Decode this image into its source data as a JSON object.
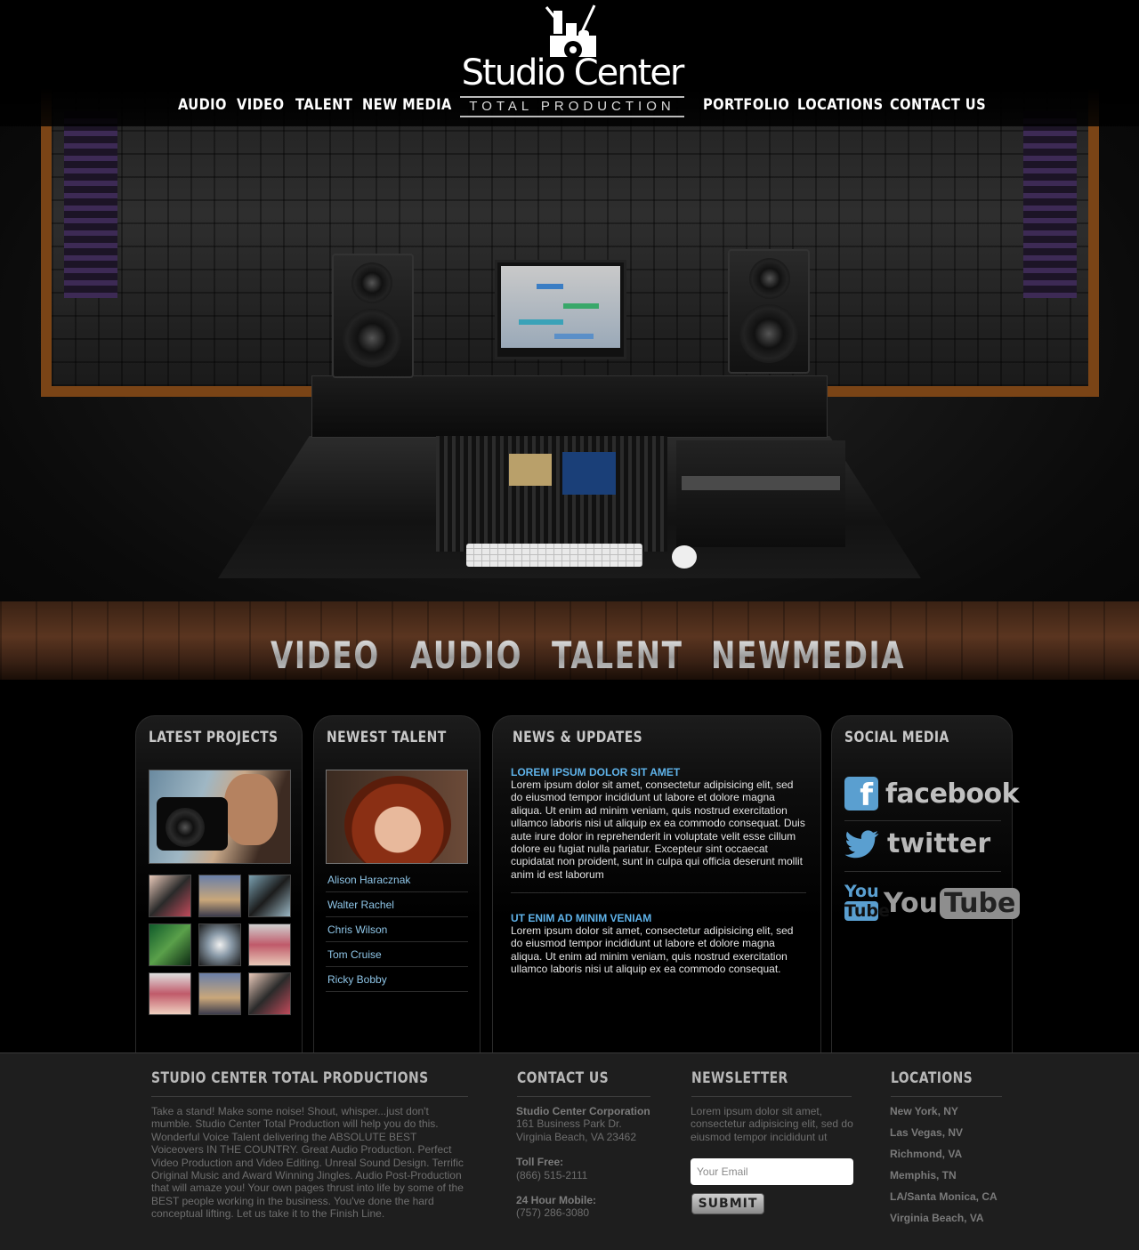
{
  "header": {
    "logo": {
      "word": "Studio Center",
      "sub": "TOTAL PRODUCTION",
      "mark": "®"
    },
    "nav_left": [
      "AUDIO",
      "VIDEO",
      "TALENT",
      "NEW MEDIA"
    ],
    "nav_right": [
      "PORTFOLIO",
      "LOCATIONS",
      "CONTACT US"
    ]
  },
  "categories": [
    "VIDEO",
    "AUDIO",
    "TALENT",
    "NEWMEDIA"
  ],
  "panels": {
    "projects": {
      "title": "LATEST PROJECTS"
    },
    "talent": {
      "title": "NEWEST TALENT",
      "names": [
        "Alison Haracznak",
        "Walter Rachel",
        "Chris Wilson",
        "Tom Cruise",
        "Ricky Bobby"
      ]
    },
    "news": {
      "title": "NEWS & UPDATES",
      "items": [
        {
          "headline": "LOREM IPSUM DOLOR SIT AMET",
          "body": "Lorem ipsum dolor sit amet, consectetur adipisicing elit, sed do eiusmod tempor incididunt ut labore et dolore magna aliqua. Ut enim ad minim veniam, quis nostrud exercitation ullamco laboris nisi ut aliquip ex ea commodo consequat. Duis aute irure dolor in reprehenderit in voluptate velit esse cillum dolore eu fugiat nulla pariatur. Excepteur sint occaecat cupidatat non proident, sunt in culpa qui officia deserunt mollit anim id est laborum"
        },
        {
          "headline": "UT ENIM AD MINIM VENIAM",
          "body": "Lorem ipsum dolor sit amet, consectetur adipisicing elit, sed do eiusmod tempor incididunt ut labore et dolore magna aliqua. Ut enim ad minim veniam, quis nostrud exercitation ullamco laboris nisi ut aliquip ex ea commodo consequat."
        }
      ]
    },
    "social": {
      "title": "SOCIAL MEDIA",
      "facebook": {
        "glyph": "f",
        "word": "facebook"
      },
      "twitter": {
        "word": "twitter"
      },
      "youtube": {
        "you": "You",
        "tube": "Tube"
      }
    }
  },
  "footer": {
    "about": {
      "title": "STUDIO CENTER TOTAL PRODUCTIONS",
      "text": "Take a stand! Make some noise! Shout, whisper...just don't mumble. Studio Center Total Production will help you do this. Wonderful Voice Talent delivering the ABSOLUTE BEST Voiceovers IN THE COUNTRY. Great Audio Production. Perfect Video Production and Video Editing. Unreal Sound Design. Terrific Original Music and Award Winning Jingles. Audio Post-Production that will amaze you! Your own pages thrust into life by some of the BEST people working in the business. You've done the hard conceptual lifting. Let us take it to the Finish Line."
    },
    "contact": {
      "title": "CONTACT US",
      "company": "Studio Center Corporation",
      "address1": "161 Business Park Dr.",
      "address2": "Virginia Beach, VA 23462",
      "tollfree_label": "Toll Free:",
      "tollfree": "(866) 515-2111",
      "mobile_label": "24 Hour Mobile:",
      "mobile": "(757) 286-3080"
    },
    "newsletter": {
      "title": "NEWSLETTER",
      "text": "Lorem ipsum dolor sit amet, consectetur adipisicing elit, sed do eiusmod tempor incididunt ut",
      "placeholder": "Your Email",
      "submit": "SUBMIT"
    },
    "locations": {
      "title": "LOCATIONS",
      "items": [
        "New York, NY",
        "Las Vegas, NV",
        "Richmond, VA",
        "Memphis, TN",
        "LA/Santa Monica, CA",
        "Virginia Beach, VA"
      ]
    }
  },
  "colors": {
    "link_blue": "#8fc6e8",
    "headline_blue": "#5fb3ea",
    "social_blue": "#5a9fd0",
    "wood": "#5a3520"
  }
}
